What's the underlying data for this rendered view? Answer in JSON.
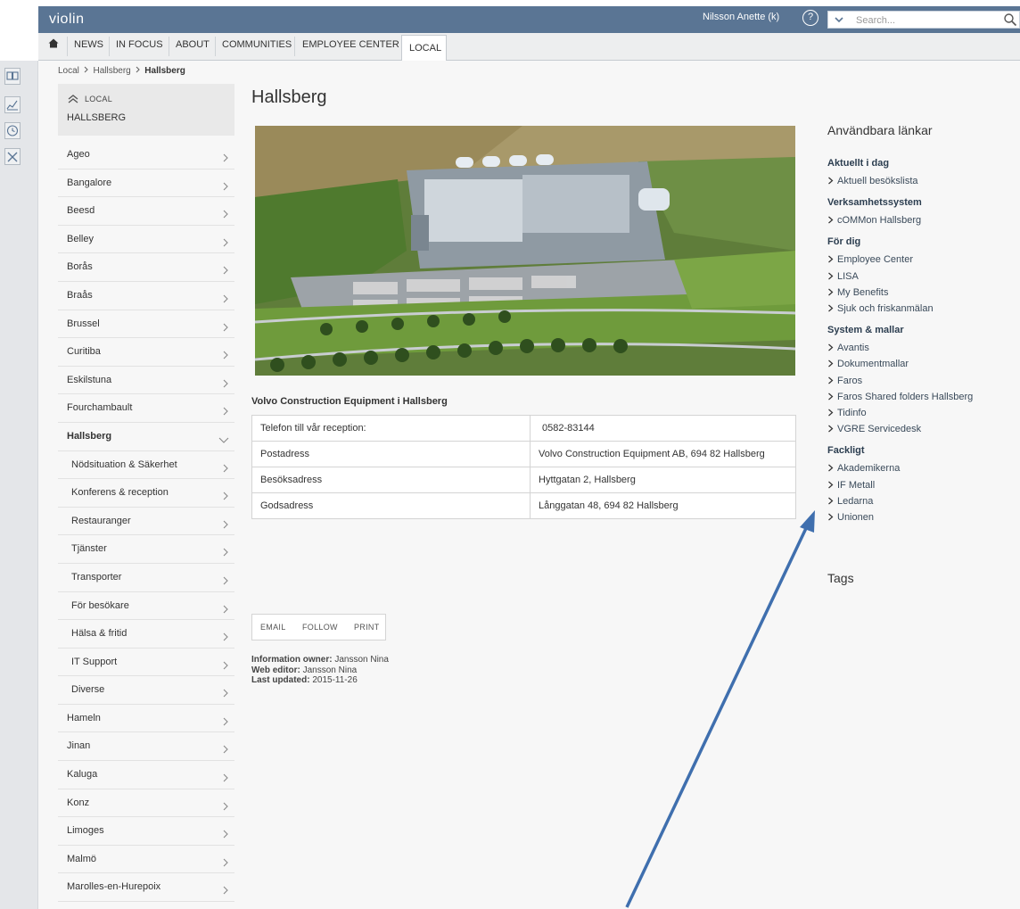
{
  "header": {
    "brand": "violin",
    "user": "Nilsson Anette (k)",
    "help_symbol": "?",
    "search_placeholder": "Search..."
  },
  "nav": {
    "items": [
      "NEWS",
      "IN FOCUS",
      "ABOUT",
      "COMMUNITIES",
      "EMPLOYEE CENTER"
    ],
    "active": "LOCAL"
  },
  "breadcrumb": {
    "first": "Local",
    "second": "Hallsberg",
    "current": "Hallsberg"
  },
  "side": {
    "head_small": "LOCAL",
    "head_big": "HALLSBERG",
    "items": [
      {
        "label": "Ageo",
        "level": 0
      },
      {
        "label": "Bangalore",
        "level": 0
      },
      {
        "label": "Beesd",
        "level": 0
      },
      {
        "label": "Belley",
        "level": 0
      },
      {
        "label": "Borås",
        "level": 0
      },
      {
        "label": "Braås",
        "level": 0
      },
      {
        "label": "Brussel",
        "level": 0
      },
      {
        "label": "Curitiba",
        "level": 0
      },
      {
        "label": "Eskilstuna",
        "level": 0
      },
      {
        "label": "Fourchambault",
        "level": 0
      },
      {
        "label": "Hallsberg",
        "level": 0,
        "current": true
      },
      {
        "label": "Nödsituation & Säkerhet",
        "level": 1
      },
      {
        "label": "Konferens & reception",
        "level": 1
      },
      {
        "label": "Restauranger",
        "level": 1
      },
      {
        "label": "Tjänster",
        "level": 1
      },
      {
        "label": "Transporter",
        "level": 1
      },
      {
        "label": "För besökare",
        "level": 1
      },
      {
        "label": "Hälsa & fritid",
        "level": 1
      },
      {
        "label": "IT Support",
        "level": 1
      },
      {
        "label": "Diverse",
        "level": 1
      },
      {
        "label": "Hameln",
        "level": 0
      },
      {
        "label": "Jinan",
        "level": 0
      },
      {
        "label": "Kaluga",
        "level": 0
      },
      {
        "label": "Konz",
        "level": 0
      },
      {
        "label": "Limoges",
        "level": 0
      },
      {
        "label": "Malmö",
        "level": 0
      },
      {
        "label": "Marolles-en-Hurepoix",
        "level": 0
      }
    ]
  },
  "content": {
    "title": "Hallsberg",
    "subtitle": "Volvo Construction Equipment i Hallsberg",
    "table": [
      [
        "Telefon till vår reception:",
        "0582-83144"
      ],
      [
        "Postadress",
        "Volvo Construction Equipment AB, 694 82 Hallsberg"
      ],
      [
        "Besöksadress",
        "Hyttgatan 2, Hallsberg"
      ],
      [
        "Godsadress",
        "Långgatan 48, 694 82 Hallsberg"
      ]
    ],
    "share": {
      "email": "EMAIL",
      "follow": "FOLLOW",
      "print": "PRINT"
    },
    "meta": {
      "owner_label": "Information owner:",
      "owner": "Jansson Nina",
      "editor_label": "Web editor:",
      "editor": "Jansson Nina",
      "updated_label": "Last updated:",
      "updated": "2015-11-26"
    }
  },
  "right": {
    "title": "Användbara länkar",
    "sections": [
      {
        "heading": "Aktuellt i dag",
        "links": [
          "Aktuell besökslista"
        ]
      },
      {
        "heading": "Verksamhetssystem",
        "links": [
          "cOMMon Hallsberg"
        ]
      },
      {
        "heading": "För dig",
        "links": [
          "Employee Center",
          "LISA",
          "My Benefits",
          "Sjuk och friskanmälan"
        ]
      },
      {
        "heading": "System & mallar",
        "links": [
          "Avantis",
          "Dokumentmallar",
          "Faros",
          "Faros Shared folders Hallsberg",
          "Tidinfo",
          "VGRE  Servicedesk"
        ]
      },
      {
        "heading": "Fackligt",
        "links": [
          "Akademikerna",
          "IF Metall",
          "Ledarna",
          "Unionen"
        ]
      }
    ],
    "tags": "Tags"
  },
  "colors": {
    "header": "#5a7594",
    "nav_bg": "#edeeef",
    "arrow": "#3f6fae",
    "page_bg": "#f7f7f7"
  },
  "icons": [
    "home-icon",
    "help-icon",
    "search-icon",
    "chevron-right-icon",
    "chevron-down-icon",
    "double-chevron-up-icon",
    "book-icon",
    "chart-icon",
    "clock-icon",
    "tools-icon"
  ]
}
